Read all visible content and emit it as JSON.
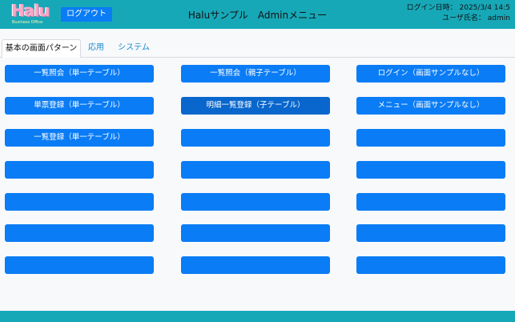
{
  "header": {
    "logo_text": "Halu",
    "logo_sub": "Business Office",
    "logout_label": "ログアウト",
    "title": "Haluサンプル　Adminメニュー",
    "login_line": "ログイン日時： 2025/3/4 14:5",
    "user_line": "ユーザ氏名： admin"
  },
  "tabs": [
    {
      "label": "基本の画面パターン",
      "active": true
    },
    {
      "label": "応用",
      "active": false
    },
    {
      "label": "システム",
      "active": false
    }
  ],
  "menu": {
    "columns": [
      [
        "一覧照会（単一テーブル）",
        "単票登録（単一テーブル）",
        "一覧登録（単一テーブル）",
        "",
        "",
        "",
        ""
      ],
      [
        "一覧照会（親子テーブル）",
        "明細一覧登録（子テーブル）",
        "",
        "",
        "",
        "",
        ""
      ],
      [
        "ログイン（画面サンプルなし）",
        "メニュー（画面サンプルなし）",
        "",
        "",
        "",
        "",
        ""
      ]
    ]
  },
  "colors": {
    "header_bg": "#17a8b8",
    "button_bg": "#0a7cf5",
    "tab_text": "#1a8ad0"
  },
  "icons": {
    "logo": "halu-logo"
  }
}
